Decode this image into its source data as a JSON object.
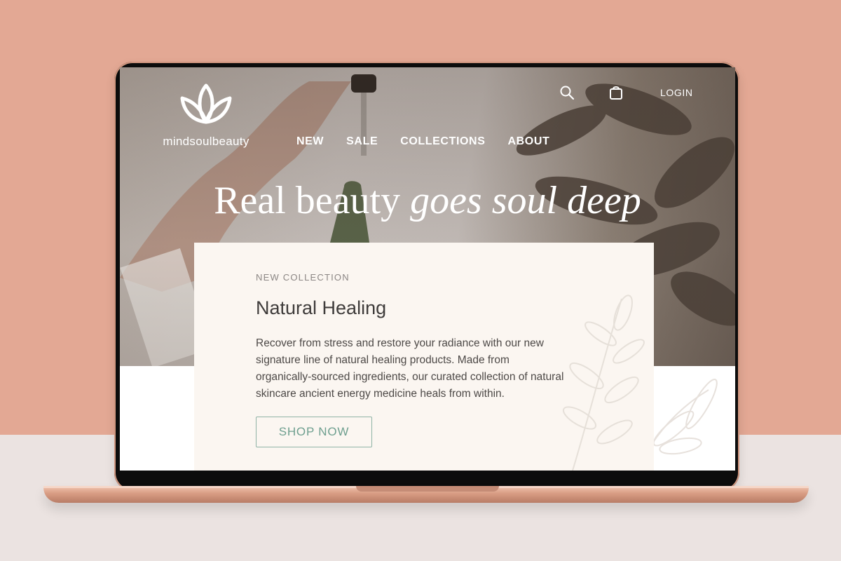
{
  "site": {
    "brand": "mindsoulbeauty",
    "nav": [
      "NEW",
      "SALE",
      "COLLECTIONS",
      "ABOUT"
    ],
    "utility": {
      "search_icon": "search-icon",
      "cart_icon": "shopping-bag-icon",
      "login_label": "LOGIN"
    },
    "headline": {
      "regular": "Real beauty",
      "italic": "goes soul deep"
    }
  },
  "card": {
    "eyebrow": "NEW COLLECTION",
    "title": "Natural Healing",
    "body": "Recover from stress and restore your radiance with our new signature line of natural healing products. Made from organically-sourced ingredients, our curated collection of natural skincare ancient energy medicine heals from within.",
    "button_label": "SHOP NOW"
  },
  "colors": {
    "backdrop": "#e3a894",
    "floor": "#ebe3e1",
    "card_bg": "#fbf6f1",
    "button_accent": "#6e9f8f",
    "laptop": "#d89c83"
  }
}
